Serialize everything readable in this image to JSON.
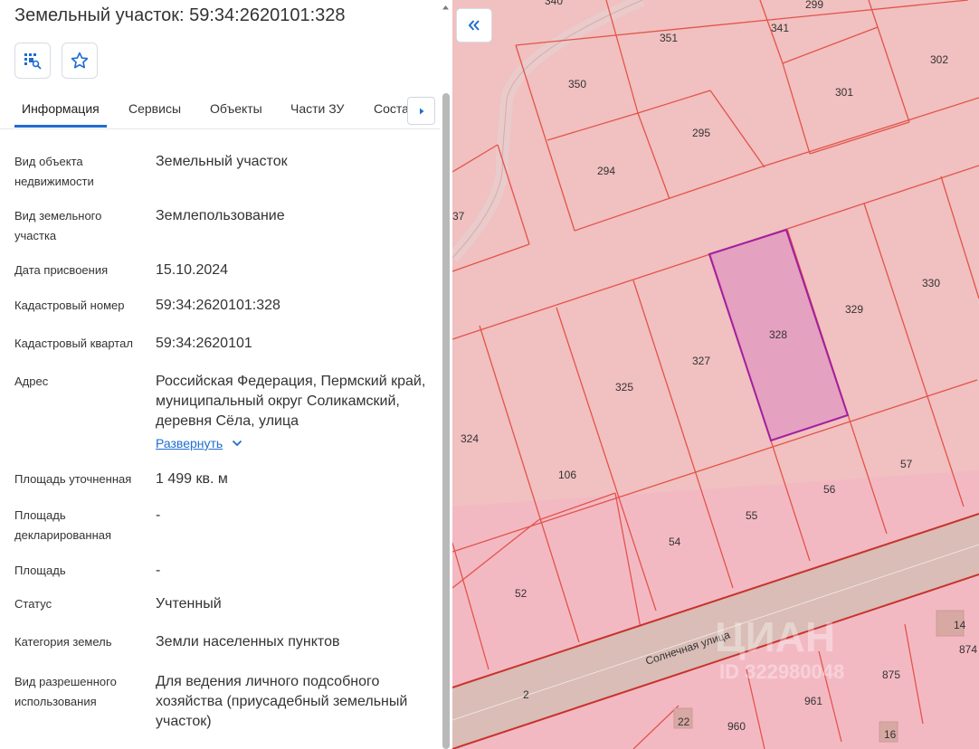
{
  "panel": {
    "title": "Земельный участок: 59:34:2620101:328",
    "tabs": [
      "Информация",
      "Сервисы",
      "Объекты",
      "Части ЗУ",
      "Соста"
    ],
    "fields": [
      {
        "label": "Вид объекта недвижимости",
        "value": "Земельный участок"
      },
      {
        "label": "Вид земельного участка",
        "value": "Землепользование"
      },
      {
        "label": "Дата присвоения",
        "value": "15.10.2024"
      },
      {
        "label": "Кадастровый номер",
        "value": "59:34:2620101:328"
      },
      {
        "label": "Кадастровый квартал",
        "value": "59:34:2620101"
      },
      {
        "label": "Адрес",
        "value": "Российская Федерация, Пермский край, муниципальный округ Соликамский, деревня Сёла, улица"
      },
      {
        "label": "Площадь уточненная",
        "value": "1 499 кв. м"
      },
      {
        "label": "Площадь декларированная",
        "value": "-"
      },
      {
        "label": "Площадь",
        "value": "-"
      },
      {
        "label": "Статус",
        "value": "Учтенный"
      },
      {
        "label": "Категория земель",
        "value": "Земли населенных пунктов"
      },
      {
        "label": "Вид разрешенного использования",
        "value": "Для ведения личного подсобного хозяйства (приусадебный земельный участок)"
      }
    ],
    "expand_label": "Развернуть"
  },
  "map": {
    "street_name": "Солнечная улица",
    "watermark": "ЦИАН",
    "watermark_id": "ID 322980048",
    "plot_numbers": [
      "340",
      "299",
      "351",
      "341",
      "302",
      "350",
      "301",
      "295",
      "294",
      "37",
      "330",
      "329",
      "328",
      "327",
      "325",
      "324",
      "106",
      "57",
      "56",
      "55",
      "54",
      "52",
      "2",
      "14",
      "874",
      "875",
      "961",
      "960",
      "22",
      "16"
    ],
    "highlight_color": "#e39bbf",
    "boundary_color": "#e2544a",
    "highlight_border": "#a21fa0",
    "street_fill": "#d9bdb6"
  }
}
